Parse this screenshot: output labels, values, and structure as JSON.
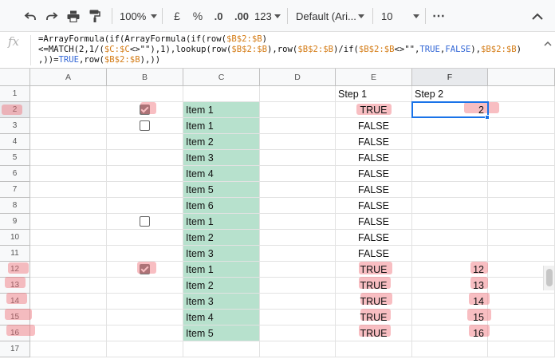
{
  "toolbar": {
    "zoom": "100%",
    "currency_symbol": "£",
    "percent_symbol": "%",
    "decrease_decimals": ".0",
    "increase_decimals": ".00",
    "number_format": "123",
    "font_family": "Default (Ari...",
    "font_size": "10",
    "more": "⋯"
  },
  "formula_bar": {
    "fx_label": "fx",
    "formula_lines": [
      [
        {
          "t": "=ArrayFormula(if(ArrayFormula(if(row(",
          "c": ""
        },
        {
          "t": "$B$2:$B",
          "c": "r"
        },
        {
          "t": ")",
          "c": ""
        }
      ],
      [
        {
          "t": "<=MATCH(2,1/(",
          "c": ""
        },
        {
          "t": "$C:$C",
          "c": "r"
        },
        {
          "t": "<>\"\"),1),lookup(row(",
          "c": ""
        },
        {
          "t": "$B$2:$B",
          "c": "r"
        },
        {
          "t": "),row(",
          "c": ""
        },
        {
          "t": "$B$2:$B",
          "c": "r"
        },
        {
          "t": ")/if(",
          "c": ""
        },
        {
          "t": "$B$2:$B",
          "c": "r"
        },
        {
          "t": "<>\"\",",
          "c": ""
        },
        {
          "t": "TRUE",
          "c": "b"
        },
        {
          "t": ",",
          "c": ""
        },
        {
          "t": "FALSE",
          "c": "b"
        },
        {
          "t": "),",
          "c": ""
        },
        {
          "t": "$B$2:$B",
          "c": "r"
        },
        {
          "t": ")",
          "c": ""
        }
      ],
      [
        {
          "t": ",))=",
          "c": ""
        },
        {
          "t": "TRUE",
          "c": "b"
        },
        {
          "t": ",row(",
          "c": ""
        },
        {
          "t": "$B$2:$B",
          "c": "r"
        },
        {
          "t": "),))",
          "c": ""
        }
      ]
    ]
  },
  "columns": [
    "A",
    "B",
    "C",
    "D",
    "E",
    "F"
  ],
  "selected_column": "F",
  "selected_cell": "F2",
  "rows": [
    {
      "num": "1",
      "b": null,
      "c": "",
      "e": "Step 1",
      "f": "Step 2"
    },
    {
      "num": "2",
      "b": "checked",
      "c": "Item 1",
      "e": "TRUE",
      "f": "2"
    },
    {
      "num": "3",
      "b": "empty",
      "c": "Item 1",
      "e": "FALSE",
      "f": ""
    },
    {
      "num": "4",
      "b": null,
      "c": "Item 2",
      "e": "FALSE",
      "f": ""
    },
    {
      "num": "5",
      "b": null,
      "c": "Item 3",
      "e": "FALSE",
      "f": ""
    },
    {
      "num": "6",
      "b": null,
      "c": "Item 4",
      "e": "FALSE",
      "f": ""
    },
    {
      "num": "7",
      "b": null,
      "c": "Item 5",
      "e": "FALSE",
      "f": ""
    },
    {
      "num": "8",
      "b": null,
      "c": "Item 6",
      "e": "FALSE",
      "f": ""
    },
    {
      "num": "9",
      "b": "empty",
      "c": "Item 1",
      "e": "FALSE",
      "f": ""
    },
    {
      "num": "10",
      "b": null,
      "c": "Item 2",
      "e": "FALSE",
      "f": ""
    },
    {
      "num": "11",
      "b": null,
      "c": "Item 3",
      "e": "FALSE",
      "f": ""
    },
    {
      "num": "12",
      "b": "checked",
      "c": "Item 1",
      "e": "TRUE",
      "f": "12"
    },
    {
      "num": "13",
      "b": null,
      "c": "Item 2",
      "e": "TRUE",
      "f": "13"
    },
    {
      "num": "14",
      "b": null,
      "c": "Item 3",
      "e": "TRUE",
      "f": "14"
    },
    {
      "num": "15",
      "b": null,
      "c": "Item 4",
      "e": "TRUE",
      "f": "15"
    },
    {
      "num": "16",
      "b": null,
      "c": "Item 5",
      "e": "TRUE",
      "f": "16"
    },
    {
      "num": "17",
      "b": null,
      "c": "",
      "e": "",
      "f": ""
    }
  ],
  "colors": {
    "green_fill": "#b7e1cd",
    "highlight": "#f06e78",
    "selection": "#1a73e8"
  }
}
